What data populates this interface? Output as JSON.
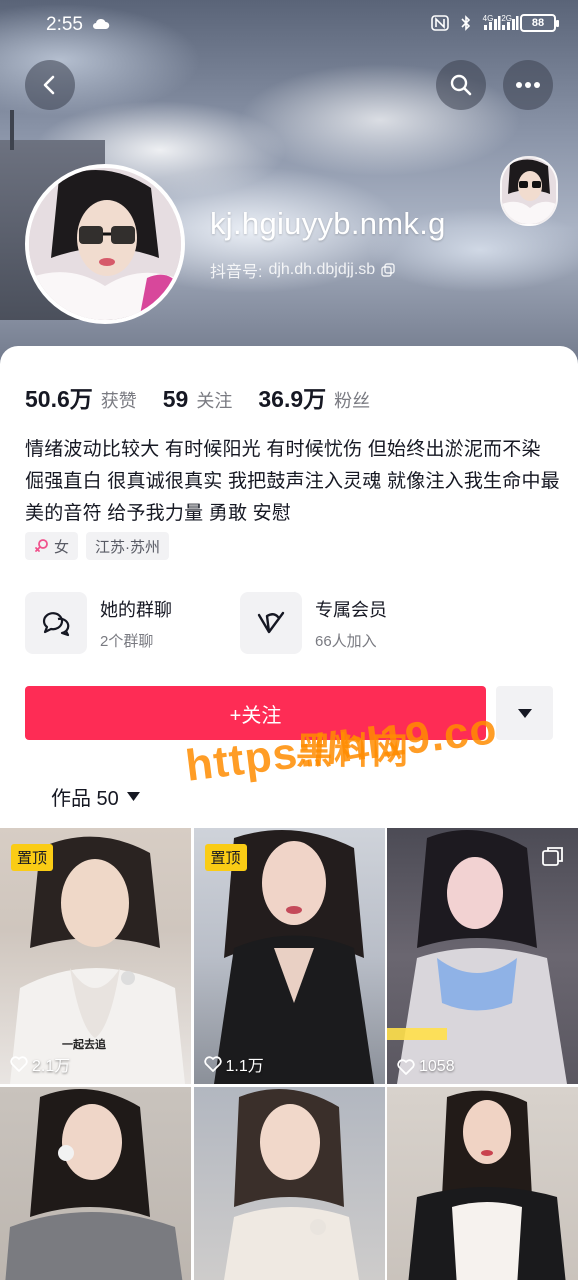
{
  "status_bar": {
    "time": "2:55",
    "network_1": "4G",
    "network_2": "2G",
    "battery": "88"
  },
  "profile": {
    "username": "kj.hgiuyyb.nmk.g",
    "douyin_id_label": "抖音号:",
    "douyin_id": "djh.dh.dbjdjj.sb"
  },
  "stats": [
    {
      "value": "50.6万",
      "label": "获赞"
    },
    {
      "value": "59",
      "label": "关注"
    },
    {
      "value": "36.9万",
      "label": "粉丝"
    }
  ],
  "bio": "情绪波动比较大 有时候阳光 有时候忧伤 但始终出淤泥而不染 倔强直白 很真诚很真实 我把鼓声注入灵魂 就像注入我生命中最美的音符 给予我力量 勇敢 安慰",
  "tags": {
    "gender": "女",
    "location": "江苏·苏州"
  },
  "features": {
    "group": {
      "title": "她的群聊",
      "subtitle": "2个群聊"
    },
    "vip": {
      "title": "专属会员",
      "subtitle": "66人加入"
    }
  },
  "actions": {
    "follow_label": "+关注"
  },
  "works_tab": {
    "label": "作品 50"
  },
  "watermark": {
    "line1": "黑料网",
    "line2": "https://hl19.co"
  },
  "videos": [
    {
      "pinned": "置顶",
      "likes": "2.1万",
      "caption": "一起去追"
    },
    {
      "pinned": "置顶",
      "likes": "1.1万"
    },
    {
      "likes": "1058",
      "multi": true
    },
    {},
    {},
    {}
  ],
  "colors": {
    "accent": "#fe2c55",
    "pin_badge": "#facc15",
    "watermark": "#ff8c00"
  }
}
